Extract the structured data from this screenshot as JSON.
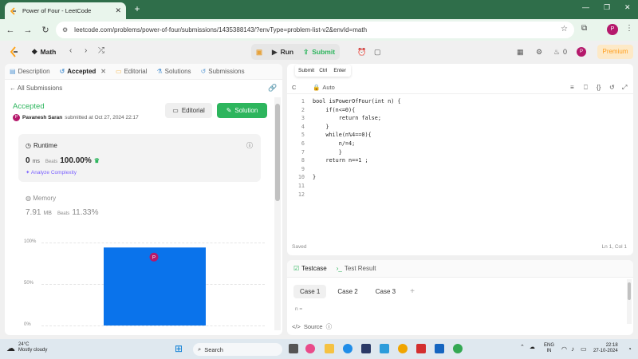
{
  "browser": {
    "tab_title": "Power of Four - LeetCode",
    "url": "leetcode.com/problems/power-of-four/submissions/1435388143/?envType=problem-list-v2&envId=math"
  },
  "nav": {
    "problem_list": "Math",
    "run_label": "Run",
    "submit_label": "Submit",
    "streak_count": "0",
    "avatar_letter": "P",
    "premium_label": "Premium"
  },
  "left_tabs": [
    {
      "label": "Description",
      "icon": "description-icon"
    },
    {
      "label": "Accepted",
      "icon": "history-icon"
    },
    {
      "label": "Editorial",
      "icon": "book-icon"
    },
    {
      "label": "Solutions",
      "icon": "flask-icon"
    },
    {
      "label": "Submissions",
      "icon": "history-icon"
    }
  ],
  "submission": {
    "back_label": "All Submissions",
    "status": "Accepted",
    "avatar_letter": "P",
    "user": "Pavanesh Saran",
    "submitted_text": "submitted at Oct 27, 2024 22:17",
    "editorial_label": "Editorial",
    "solution_label": "Solution"
  },
  "runtime": {
    "label": "Runtime",
    "value": "0",
    "unit": "ms",
    "beats_label": "Beats",
    "beats": "100.00%",
    "analyze_label": "Analyze Complexity"
  },
  "memory": {
    "label": "Memory",
    "value": "7.91",
    "unit": "MB",
    "beats_label": "Beats",
    "beats": "11.33%"
  },
  "chart_data": {
    "type": "bar",
    "yticks": [
      "100%",
      "50%",
      "0%"
    ],
    "ylim": [
      0,
      100
    ],
    "values": [
      94
    ],
    "marker": "P",
    "color": "#0a73eb"
  },
  "tooltip": {
    "label": "Submit",
    "key1": "Ctrl",
    "key2": "Enter"
  },
  "editor": {
    "language": "C",
    "mode": "Auto",
    "code_lines": [
      "bool isPowerOfFour(int n) {",
      "    if(n<=0){",
      "        return false;",
      "    }",
      "    while(n%4==0){",
      "        n/=4;",
      "        }",
      "    return n==1 ;",
      "",
      "}",
      "",
      ""
    ],
    "status": "Saved",
    "cursor": "Ln 1, Col 1"
  },
  "testcase": {
    "tab_testcase": "Testcase",
    "tab_result": "Test Result",
    "cases": [
      "Case 1",
      "Case 2",
      "Case 3"
    ],
    "input_label": "n =",
    "source_label": "Source"
  },
  "taskbar": {
    "temp": "24°C",
    "weather": "Mostly cloudy",
    "search": "Search",
    "lang1": "ENG",
    "lang2": "IN",
    "time": "22:18",
    "date": "27-10-2024"
  }
}
